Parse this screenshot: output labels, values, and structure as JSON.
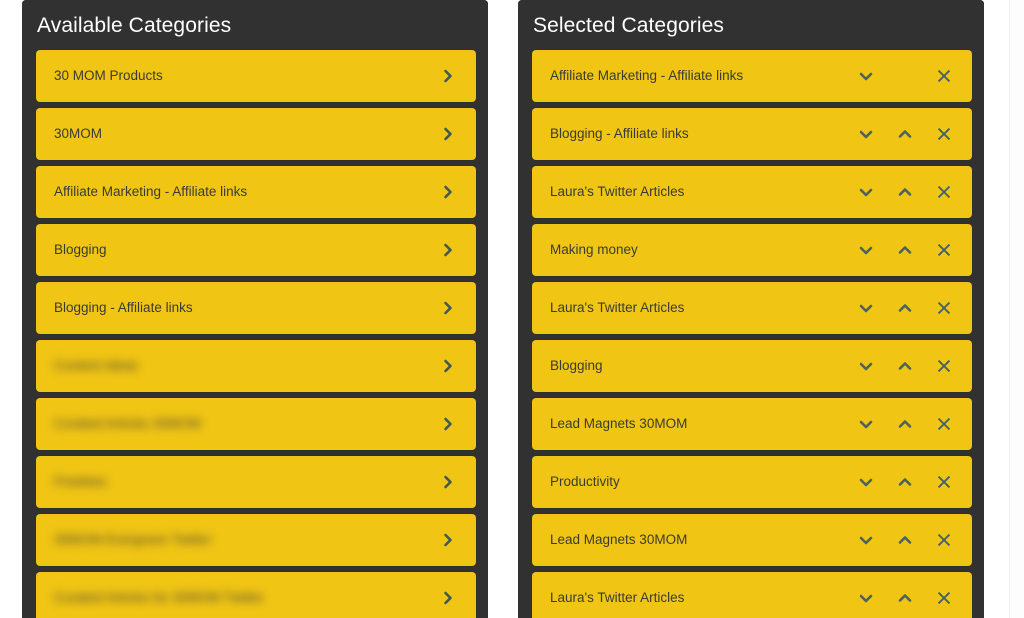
{
  "colors": {
    "panel_bg": "#313131",
    "item_bg": "#f0c514",
    "item_text": "#3b3b33",
    "header_text": "#ffffff",
    "icon": "#3f5a52",
    "page_bg": "#ffffff"
  },
  "available": {
    "title": "Available Categories",
    "action_icon": "chevron-right-icon",
    "items": [
      {
        "label": "30 MOM Products",
        "redacted": false
      },
      {
        "label": "30MOM",
        "redacted": false
      },
      {
        "label": "Affiliate Marketing - Affiliate links",
        "redacted": false
      },
      {
        "label": "Blogging",
        "redacted": false
      },
      {
        "label": "Blogging - Affiliate links",
        "redacted": false
      },
      {
        "label": "Content Ideas",
        "redacted": true
      },
      {
        "label": "Curated Articles 30MOM",
        "redacted": true
      },
      {
        "label": "Freebies",
        "redacted": true
      },
      {
        "label": "30MOM Evergreen Twitter",
        "redacted": true
      },
      {
        "label": "Curated Articles for 30MOM Twitter",
        "redacted": true
      }
    ]
  },
  "selected": {
    "title": "Selected Categories",
    "icons": {
      "move_down": "chevron-down-icon",
      "move_up": "chevron-up-icon",
      "remove": "close-x-icon"
    },
    "items": [
      {
        "label": "Affiliate Marketing - Affiliate links",
        "has_up": false
      },
      {
        "label": "Blogging - Affiliate links",
        "has_up": true
      },
      {
        "label": "Laura's Twitter Articles",
        "has_up": true
      },
      {
        "label": "Making money",
        "has_up": true
      },
      {
        "label": "Laura's Twitter Articles",
        "has_up": true
      },
      {
        "label": "Blogging",
        "has_up": true
      },
      {
        "label": "Lead Magnets 30MOM",
        "has_up": true
      },
      {
        "label": "Productivity",
        "has_up": true
      },
      {
        "label": "Lead Magnets 30MOM",
        "has_up": true
      },
      {
        "label": "Laura's Twitter Articles",
        "has_up": true
      }
    ]
  }
}
